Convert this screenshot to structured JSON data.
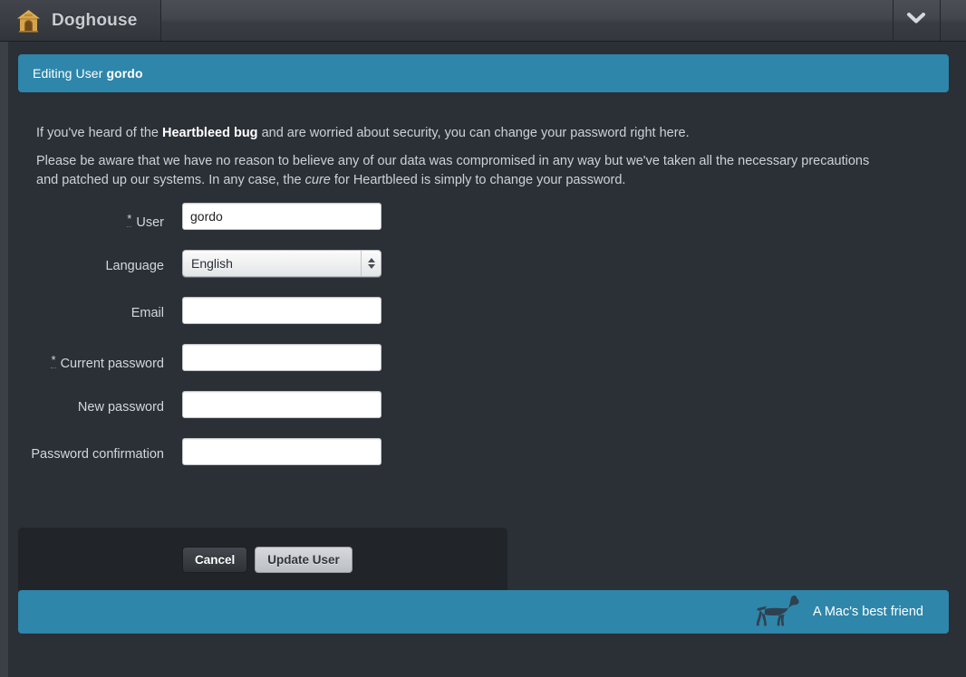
{
  "toolbar": {
    "app_title": "Doghouse",
    "app_icon": "doghouse-icon",
    "menu_icon": "chevron-down-icon"
  },
  "panel": {
    "header_prefix": "Editing User ",
    "header_user": "gordo"
  },
  "paragraphs": {
    "p1_a": "If you've heard of the ",
    "p1_b": "Heartbleed bug",
    "p1_c": " and are worried about security, you can change your password right here.",
    "p2_a": "Please be aware that we have no reason to believe any of our data was compromised in any way but we've taken all the necessary precautions and patched up our systems. In any case, the ",
    "p2_b": "cure",
    "p2_c": " for Heartbleed is simply to change your password."
  },
  "form": {
    "required_marker": "*",
    "fields": [
      {
        "label": "User",
        "required": true,
        "type": "text",
        "value": "gordo",
        "placeholder": ""
      },
      {
        "label": "Language",
        "required": false,
        "type": "select",
        "value": "English",
        "options": [
          "English"
        ]
      },
      {
        "label": "Email",
        "required": false,
        "type": "text",
        "value": "",
        "placeholder": ""
      },
      {
        "label": "Current password",
        "required": true,
        "type": "password",
        "value": "",
        "placeholder": ""
      },
      {
        "label": "New password",
        "required": false,
        "type": "password",
        "value": "",
        "placeholder": ""
      },
      {
        "label": "Password confirmation",
        "required": false,
        "type": "password",
        "value": "",
        "placeholder": ""
      }
    ]
  },
  "actions": {
    "cancel_label": "Cancel",
    "submit_label": "Update User"
  },
  "footer": {
    "tagline": "A Mac's best friend",
    "icon": "dog-silhouette-icon"
  },
  "colors": {
    "accent": "#2e86aa",
    "page_bg": "#2b2f36",
    "panel_bg": "#212429",
    "toolbar_bg": "#3e4248",
    "text": "#cdd2d8"
  }
}
